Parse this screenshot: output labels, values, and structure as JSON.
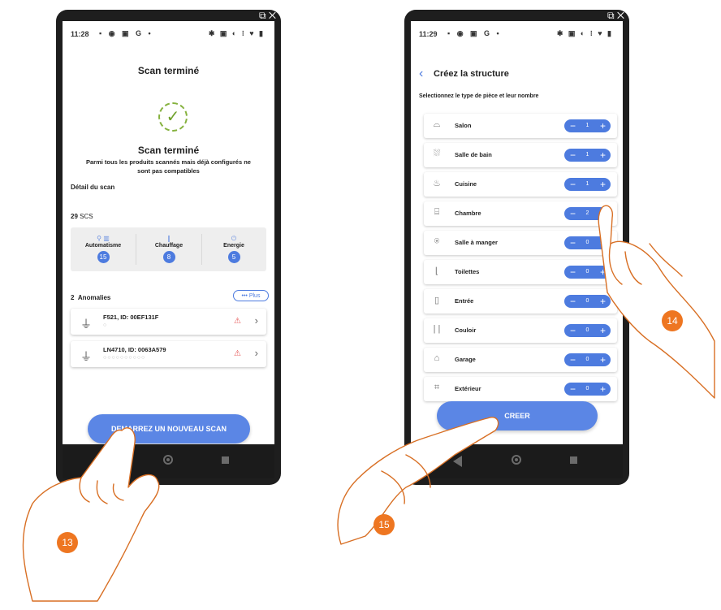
{
  "colors": {
    "accent": "#4d7bdf",
    "marker": "#ee7621",
    "success": "#86b23f",
    "warning": "#e55050"
  },
  "left_phone": {
    "status": {
      "time": "11:28",
      "left_icons": "▪ ◉ ▣ G •",
      "right_icons": "✱ ▣ ◐ ⁝ ♥ ▮"
    },
    "header_title": "Scan terminé",
    "result_title": "Scan terminé",
    "result_description": "Parmi tous les produits scannés mais déjà configurés ne sont pas compatibles",
    "detail_label": "Détail du scan",
    "count": {
      "value": "29",
      "unit": "SCS"
    },
    "categories": [
      {
        "label": "Automatisme",
        "count": "15",
        "icon": "blinds-icon"
      },
      {
        "label": "Chauffage",
        "count": "8",
        "icon": "thermometer-icon"
      },
      {
        "label": "Energie",
        "count": "5",
        "icon": "plug-icon"
      }
    ],
    "anomalies": {
      "count": "2",
      "label": "Anomalies",
      "more_button": "••• Plus"
    },
    "devices": [
      {
        "name": "F521, ID: 00EF131F",
        "dots": "○"
      },
      {
        "name": "LN4710, ID: 0063A579",
        "dots": "○○○○○○○○○○"
      }
    ],
    "action_button": "DEMARREZ UN NOUVEAU SCAN"
  },
  "right_phone": {
    "status": {
      "time": "11:29",
      "left_icons": "▪ ◉ ▣ G •",
      "right_icons": "✱ ▣ ◐ ⁝ ♥ ▮"
    },
    "header_title": "Créez la structure",
    "subtitle": "Selectionnez le type de pièce et leur nombre",
    "rooms": [
      {
        "name": "Salon",
        "count": "1",
        "icon": "sofa-icon"
      },
      {
        "name": "Salle de bain",
        "count": "1",
        "icon": "shower-icon"
      },
      {
        "name": "Cuisine",
        "count": "1",
        "icon": "pot-icon"
      },
      {
        "name": "Chambre",
        "count": "2",
        "icon": "bed-icon"
      },
      {
        "name": "Salle à manger",
        "count": "0",
        "icon": "cutlery-icon"
      },
      {
        "name": "Toilettes",
        "count": "0",
        "icon": "toilet-icon"
      },
      {
        "name": "Entrée",
        "count": "0",
        "icon": "door-icon"
      },
      {
        "name": "Couloir",
        "count": "0",
        "icon": "corridor-icon"
      },
      {
        "name": "Garage",
        "count": "0",
        "icon": "garage-icon"
      },
      {
        "name": "Extérieur",
        "count": "0",
        "icon": "fence-icon"
      }
    ],
    "action_button": "CREER"
  },
  "markers": [
    "13",
    "14",
    "15"
  ]
}
